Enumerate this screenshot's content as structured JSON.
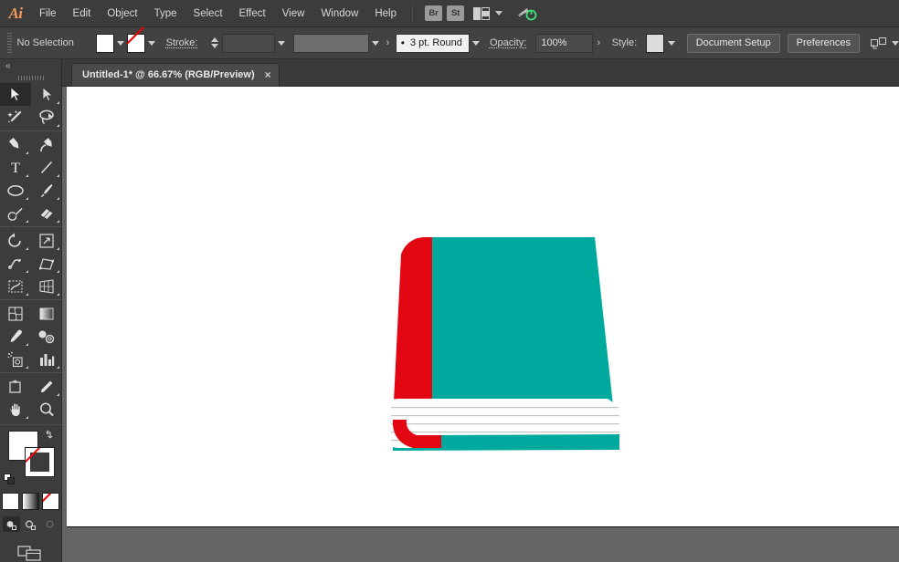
{
  "app": {
    "name": "Adobe Illustrator",
    "logo_text": "Ai"
  },
  "menubar": {
    "items": [
      {
        "label": "File"
      },
      {
        "label": "Edit"
      },
      {
        "label": "Object"
      },
      {
        "label": "Type"
      },
      {
        "label": "Select"
      },
      {
        "label": "Effect"
      },
      {
        "label": "View"
      },
      {
        "label": "Window"
      },
      {
        "label": "Help"
      }
    ],
    "bridge_label": "Br",
    "stock_label": "St",
    "arrange_icon": "arrange-documents-icon",
    "arrange_chevron": "chevron-down-icon",
    "sync_icon": "sync-settings-icon"
  },
  "controlbar": {
    "selection_status": "No Selection",
    "fill_swatch": {
      "name": "fill-swatch",
      "color": "#ffffff"
    },
    "stroke_swatch": {
      "name": "stroke-swatch",
      "color": "none"
    },
    "stroke_label": "Stroke:",
    "stroke_weight_value": "",
    "stroke_profile_value": "",
    "brush_definition": "3 pt. Round",
    "opacity_label": "Opacity:",
    "opacity_value": "100%",
    "style_label": "Style:",
    "style_swatch_color": "#d8d8d8",
    "document_setup_label": "Document Setup",
    "preferences_label": "Preferences",
    "align_icon": "align-transform-icon",
    "align_chevron": "chevron-down-icon"
  },
  "tabbar": {
    "document_tab": {
      "title": "Untitled-1* @ 66.67% (RGB/Preview)",
      "close_label": "×"
    }
  },
  "toolbar": {
    "collapse_label": "«",
    "tools": [
      {
        "name": "selection-tool",
        "active": true
      },
      {
        "name": "direct-selection-tool",
        "active": false
      },
      {
        "name": "magic-wand-tool",
        "active": false
      },
      {
        "name": "lasso-tool",
        "active": false
      },
      {
        "name": "pen-tool",
        "active": false
      },
      {
        "name": "curvature-tool",
        "active": false
      },
      {
        "name": "type-tool",
        "active": false
      },
      {
        "name": "line-segment-tool",
        "active": false
      },
      {
        "name": "ellipse-tool",
        "active": false
      },
      {
        "name": "paintbrush-tool",
        "active": false
      },
      {
        "name": "blob-brush-tool",
        "active": false
      },
      {
        "name": "eraser-tool",
        "active": false
      },
      {
        "name": "rotate-tool",
        "active": false
      },
      {
        "name": "scale-tool",
        "active": false
      },
      {
        "name": "width-tool",
        "active": false
      },
      {
        "name": "free-transform-tool",
        "active": false
      },
      {
        "name": "shape-builder-tool",
        "active": false
      },
      {
        "name": "perspective-grid-tool",
        "active": false
      },
      {
        "name": "mesh-tool",
        "active": false
      },
      {
        "name": "gradient-tool",
        "active": false
      },
      {
        "name": "eyedropper-tool",
        "active": false
      },
      {
        "name": "blend-tool",
        "active": false
      },
      {
        "name": "symbol-sprayer-tool",
        "active": false
      },
      {
        "name": "column-graph-tool",
        "active": false
      },
      {
        "name": "artboard-tool",
        "active": false
      },
      {
        "name": "slice-tool",
        "active": false
      },
      {
        "name": "hand-tool",
        "active": false
      },
      {
        "name": "zoom-tool",
        "active": false
      }
    ],
    "fill_color": "#ffffff",
    "stroke_color": "none",
    "swap_icon": "swap-fill-stroke-icon",
    "default_icon": "default-fill-stroke-icon",
    "color_mode": "color-fill-button",
    "gradient_mode": "gradient-fill-button",
    "none_mode": "none-fill-button",
    "draw_modes": [
      {
        "name": "draw-normal-button",
        "active": true
      },
      {
        "name": "draw-behind-button",
        "active": false
      },
      {
        "name": "draw-inside-button",
        "active": false
      }
    ],
    "screen_mode": "change-screen-mode-button"
  },
  "canvas": {
    "artboard_background": "#ffffff",
    "canvas_background": "#646464",
    "artwork": {
      "name": "book-illustration",
      "description": "Closed book viewed at an angle",
      "colors": {
        "spine_red": "#E30613",
        "cover_teal": "#00A99D",
        "pages_white": "#FFFFFF",
        "page_line": "#BFBFBF"
      },
      "page_line_count": 6
    }
  }
}
